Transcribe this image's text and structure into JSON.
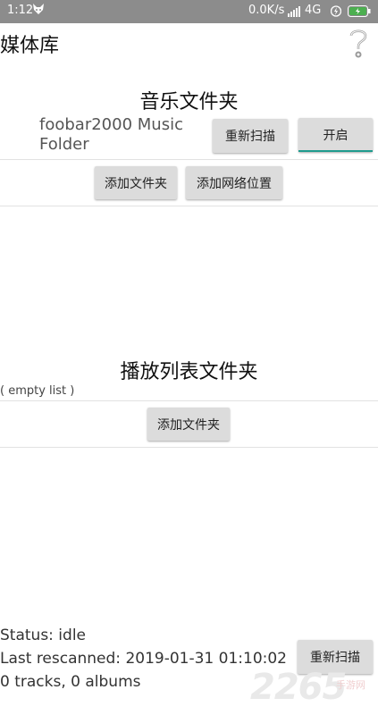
{
  "status_bar": {
    "time": "1:12",
    "speed": "0.0K/s",
    "network": "4G",
    "icons": [
      "fox-icon",
      "signal-icon",
      "lightning-icon",
      "battery-icon"
    ],
    "background": "#8c8c8c",
    "battery_color": "#4caf50"
  },
  "appbar": {
    "title": "媒体库",
    "help_icon": "question-mark-icon"
  },
  "music_section": {
    "title": "音乐文件夹",
    "folder_name": "foobar2000 Music Folder",
    "rescan_label": "重新扫描",
    "toggle_label": "开启",
    "add_folder_label": "添加文件夹",
    "add_network_label": "添加网络位置"
  },
  "playlist_section": {
    "title": "播放列表文件夹",
    "empty_text": "( empty list )",
    "add_folder_label": "添加文件夹"
  },
  "footer": {
    "status": "Status: idle",
    "last_rescanned": "Last rescanned: 2019-01-31 01:10:02",
    "counts": "0 tracks, 0 albums",
    "rescan_label": "重新扫描"
  },
  "watermark": {
    "text": "2265",
    "sub": "手游网"
  },
  "colors": {
    "accent": "#1e9b8e",
    "button_bg": "#dcdcdc"
  }
}
